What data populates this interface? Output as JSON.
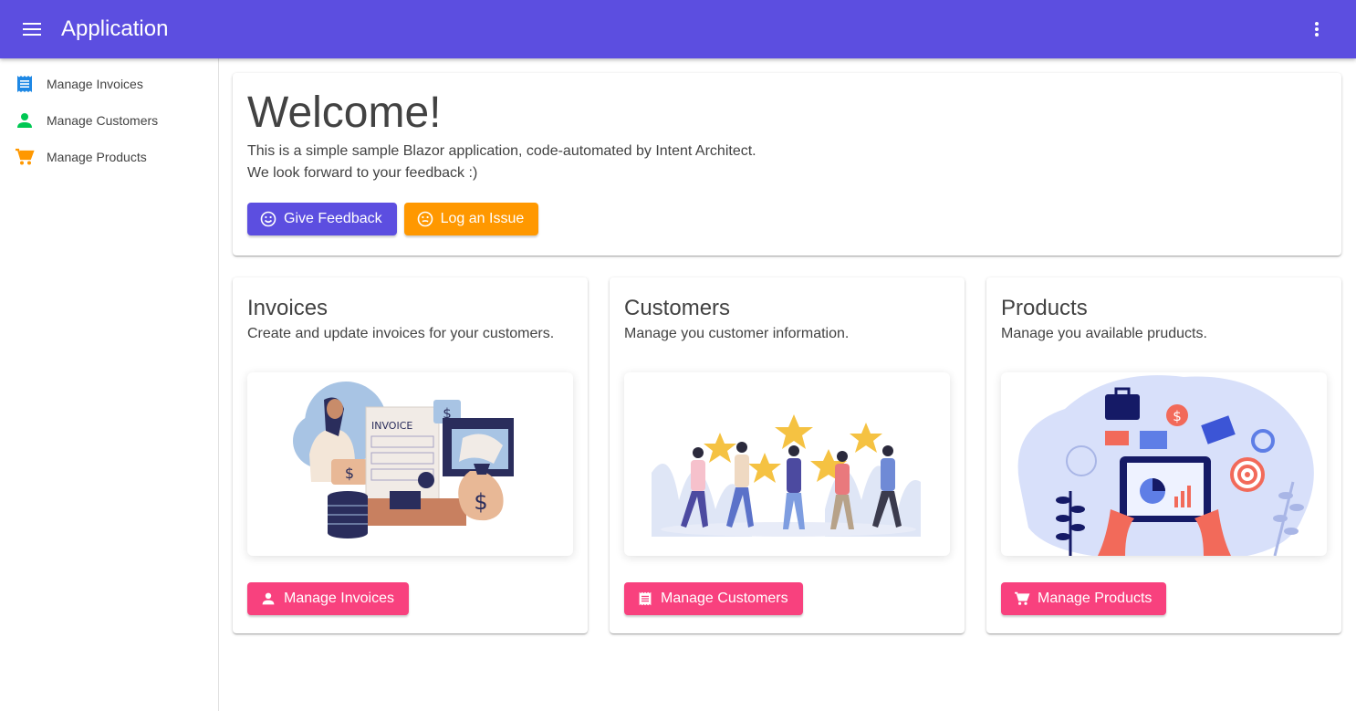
{
  "appbar": {
    "title": "Application",
    "menu_icon": "menu-icon",
    "more_icon": "more-vert-icon"
  },
  "drawer": {
    "items": [
      {
        "label": "Manage Invoices",
        "icon": "receipt-icon",
        "color": "#1e88e5"
      },
      {
        "label": "Manage Customers",
        "icon": "person-icon",
        "color": "#00c853"
      },
      {
        "label": "Manage Products",
        "icon": "cart-icon",
        "color": "#ff9800"
      }
    ]
  },
  "welcome": {
    "title": "Welcome!",
    "line1": "This is a simple sample Blazor application, code-automated by Intent Architect.",
    "line2": "We look forward to your feedback :)",
    "feedback_label": "Give Feedback",
    "issue_label": "Log an Issue"
  },
  "cards": [
    {
      "title": "Invoices",
      "text": "Create and update invoices for your customers.",
      "button": "Manage Invoices",
      "button_icon": "person-icon"
    },
    {
      "title": "Customers",
      "text": "Manage you customer information.",
      "button": "Manage Customers",
      "button_icon": "receipt-icon"
    },
    {
      "title": "Products",
      "text": "Manage you available pruducts.",
      "button": "Manage Products",
      "button_icon": "cart-icon"
    }
  ],
  "illustrations": {
    "invoice_label": "INVOICE"
  },
  "colors": {
    "primary": "#5c4ee0",
    "warning": "#ff9800",
    "pink": "#f8417e"
  }
}
